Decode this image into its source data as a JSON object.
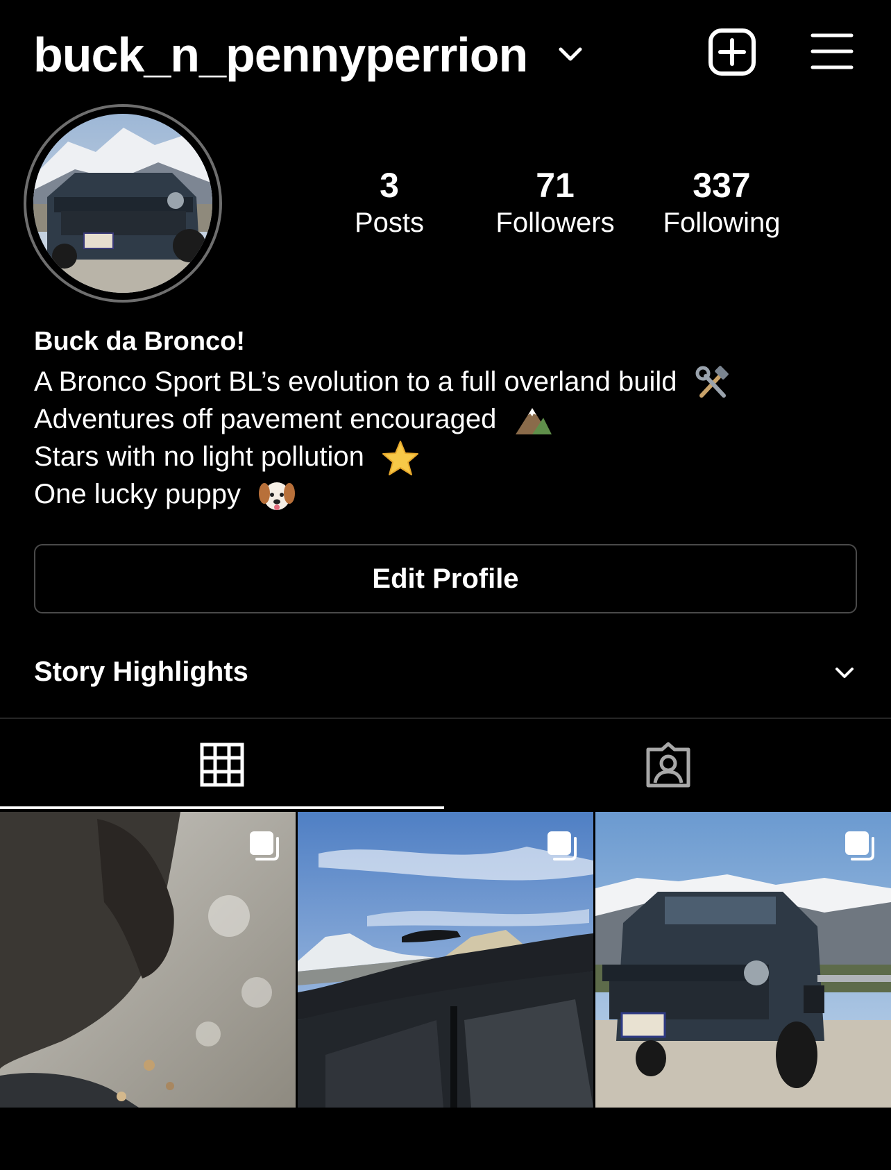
{
  "header": {
    "username": "buck_n_pennyperrion",
    "icons": [
      "chevron-down-icon",
      "add-post-icon",
      "hamburger-menu-icon"
    ]
  },
  "stats": [
    {
      "value": "3",
      "label": "Posts"
    },
    {
      "value": "71",
      "label": "Followers"
    },
    {
      "value": "337",
      "label": "Following"
    }
  ],
  "bio": {
    "name": "Buck da Bronco!",
    "lines": [
      {
        "text": "A Bronco Sport BL’s evolution to a full overland build",
        "emoji": "hammer-and-wrench-emoji"
      },
      {
        "text": "Adventures off pavement encouraged",
        "emoji": "mountain-emoji"
      },
      {
        "text": "Stars with no light pollution",
        "emoji": "star-emoji"
      },
      {
        "text": "One lucky puppy",
        "emoji": "dog-face-emoji"
      }
    ]
  },
  "edit_profile_label": "Edit Profile",
  "story_highlights_label": "Story Highlights",
  "tabs": [
    {
      "icon": "grid-icon",
      "selected": true
    },
    {
      "icon": "tagged-person-icon",
      "selected": false
    }
  ],
  "posts": [
    {
      "subject": "dog",
      "multiple": true
    },
    {
      "subject": "roof-rack",
      "multiple": true
    },
    {
      "subject": "bronco-mountains",
      "multiple": true
    }
  ],
  "colors": {
    "background": "#000000",
    "text": "#ffffff",
    "border": "#4a4a4a",
    "divider": "#262626"
  }
}
